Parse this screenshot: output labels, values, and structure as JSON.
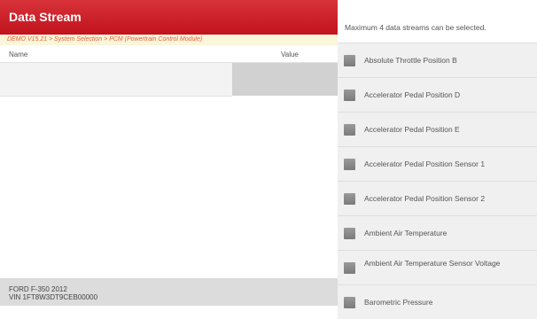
{
  "header": {
    "title": "Data Stream"
  },
  "breadcrumb": "DEMO V15.21 > System Selection > PCM (Powertrain Control Module)",
  "table": {
    "col_name": "Name",
    "col_value": "Value"
  },
  "vehicle": {
    "model": "FORD F-350 2012",
    "vin": "VIN 1FT8W3DT9CEB00000"
  },
  "selection": {
    "hint": "Maximum 4 data streams can be selected.",
    "items": [
      "Absolute Throttle Position B",
      "Accelerator Pedal Position D",
      "Accelerator Pedal Position E",
      "Accelerator Pedal Position Sensor 1",
      "Accelerator Pedal Position Sensor 2",
      "Ambient Air Temperature",
      "Ambient Air Temperature Sensor Voltage",
      "Barometric Pressure"
    ]
  }
}
